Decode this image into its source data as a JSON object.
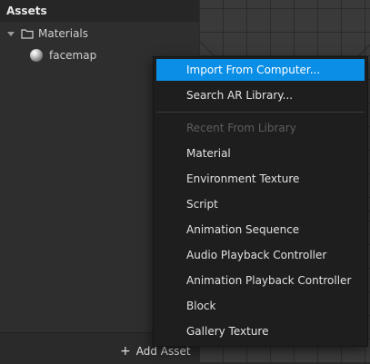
{
  "assets_panel": {
    "title": "Assets",
    "tree": [
      {
        "label": "Materials",
        "icon": "folder-icon",
        "expanded": true
      },
      {
        "label": "facemap",
        "icon": "material-sphere-icon"
      }
    ],
    "footer": {
      "add_label": "Add Asset",
      "add_icon": "plus-icon"
    }
  },
  "context_menu": {
    "items": [
      {
        "label": "Import From Computer...",
        "state": "highlighted"
      },
      {
        "label": "Search AR Library...",
        "state": "normal"
      },
      {
        "label": "Recent From Library",
        "state": "disabled"
      },
      {
        "label": "Material",
        "state": "normal"
      },
      {
        "label": "Environment Texture",
        "state": "normal"
      },
      {
        "label": "Script",
        "state": "normal"
      },
      {
        "label": "Animation Sequence",
        "state": "normal"
      },
      {
        "label": "Audio Playback Controller",
        "state": "normal"
      },
      {
        "label": "Animation Playback Controller",
        "state": "normal"
      },
      {
        "label": "Block",
        "state": "normal"
      },
      {
        "label": "Gallery Texture",
        "state": "normal"
      }
    ]
  },
  "colors": {
    "highlight": "#0b8ee6",
    "menu_background": "#1e1e1e",
    "panel_background": "#2e2e2e",
    "disabled_text": "#5e5e5e"
  }
}
